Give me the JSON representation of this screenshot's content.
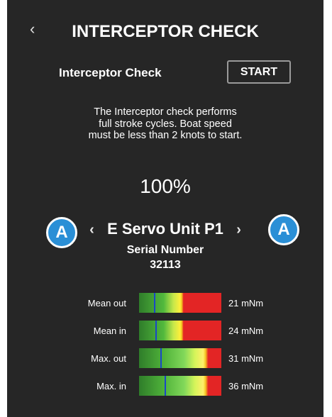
{
  "header": {
    "back_icon": "‹",
    "title": "INTERCEPTOR CHECK"
  },
  "check": {
    "label": "Interceptor Check",
    "start_button": "START",
    "description": [
      "The Interceptor check performs",
      "full stroke cycles. Boat speed",
      "must be less than 2 knots to start."
    ],
    "progress": "100%"
  },
  "unit": {
    "prev_icon": "‹",
    "next_icon": "›",
    "name": "E Servo Unit P1",
    "serial_label": "Serial Number",
    "serial_value": "32113",
    "badge_left": "A",
    "badge_right": "A"
  },
  "measurements": [
    {
      "label": "Mean out",
      "value": "21 mNm",
      "level": 0.18
    },
    {
      "label": "Mean in",
      "value": "24 mNm",
      "level": 0.2
    },
    {
      "label": "Max. out",
      "value": "31 mNm",
      "level": 0.26
    },
    {
      "label": "Max. in",
      "value": "36 mNm",
      "level": 0.31
    }
  ],
  "colors": {
    "background": "#262626",
    "badge": "#2a8fd6",
    "marker": "#1947c8"
  }
}
